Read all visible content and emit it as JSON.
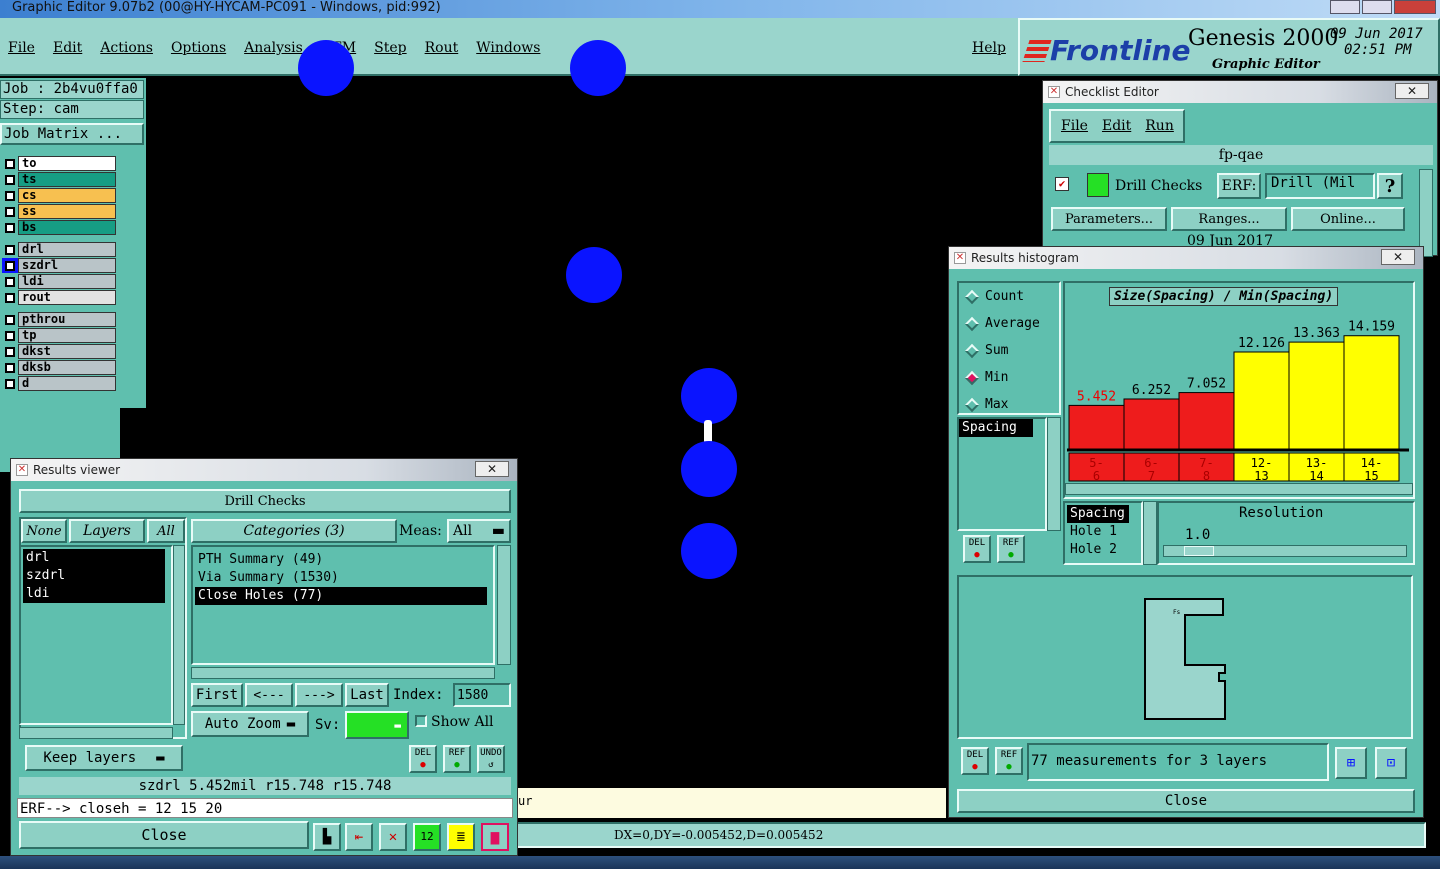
{
  "window_title": "Graphic Editor 9.07b2 (00@HY-HYCAM-PC091 - Windows, pid:992)",
  "menu": [
    "File",
    "Edit",
    "Actions",
    "Options",
    "Analysis",
    "DFM",
    "Step",
    "Rout",
    "Windows"
  ],
  "help": "Help",
  "brand": {
    "logo": "Frontline",
    "product": "Genesis 2000",
    "subtitle": "Graphic Editor",
    "date": "09 Jun 2017",
    "time": "02:51 PM"
  },
  "job": {
    "job_label": "Job : 2b4vu0ffa0",
    "step_label": "Step: cam",
    "matrix_btn": "Job Matrix ..."
  },
  "layers": [
    {
      "name": "to",
      "color": "#ffffff"
    },
    {
      "name": "ts",
      "color": "#169d84"
    },
    {
      "name": "cs",
      "color": "#f7c050"
    },
    {
      "name": "ss",
      "color": "#f7c050"
    },
    {
      "name": "bs",
      "color": "#169d84"
    },
    {
      "name": "drl",
      "color": "#b9c4c8"
    },
    {
      "name": "szdrl",
      "color": "#b9c4c8"
    },
    {
      "name": "ldi",
      "color": "#b9c4c8"
    },
    {
      "name": "rout",
      "color": "#e2e2e2"
    },
    {
      "name": "pthrou",
      "color": "#b9c4c8"
    },
    {
      "name": "tp",
      "color": "#b9c4c8"
    },
    {
      "name": "dkst",
      "color": "#b9c4c8"
    },
    {
      "name": "dksb",
      "color": "#b9c4c8"
    },
    {
      "name": "d",
      "color": "#b9c4c8"
    }
  ],
  "results_viewer": {
    "title": "Results viewer",
    "heading": "Drill Checks",
    "none_btn": "None",
    "layers_btn": "Layers",
    "all_btn": "All",
    "categories_btn": "Categories (3)",
    "meas_label": "Meas:",
    "meas_value": "All",
    "layer_list": [
      "drl",
      "szdrl",
      "ldi"
    ],
    "categories": [
      "PTH Summary (49)",
      "Via Summary (1530)",
      "Close Holes (77)"
    ],
    "first": "First",
    "prev": "<---",
    "next": "--->",
    "last": "Last",
    "index_label": "Index:",
    "index_value": "1580",
    "auto_zoom": "Auto Zoom",
    "sv_label": "Sv:",
    "show_all": "Show All",
    "keep_layers": "Keep layers",
    "del": "DEL",
    "ref": "REF",
    "undo": "UNDO",
    "info": "szdrl 5.452mil  r15.748  r15.748",
    "erf": "ERF--> closeh = 12 15 20",
    "close": "Close"
  },
  "checklist": {
    "title": "Checklist Editor",
    "menu": [
      "File",
      "Edit",
      "Run"
    ],
    "name": "fp-qae",
    "check_name": "Drill Checks",
    "erf_label": "ERF:",
    "erf_value": "Drill (Mil",
    "help": "?",
    "parameters": "Parameters...",
    "ranges": "Ranges...",
    "online": "Online...",
    "date": "09 Jun 2017"
  },
  "histogram": {
    "title": "Results histogram",
    "modes": [
      "Count",
      "Average",
      "Sum",
      "Min",
      "Max"
    ],
    "selected_mode": "Min",
    "list_item": "Spacing",
    "chart_title": "Size(Spacing) / Min(Spacing)",
    "del": "DEL",
    "ref": "REF",
    "spacing_list": [
      "Spacing",
      "Hole 1",
      "Hole 2"
    ],
    "resolution_label": "Resolution",
    "resolution_value": "1.0",
    "preview_tag": "Fs",
    "summary": "77 measurements for 3 layers",
    "close": "Close"
  },
  "chart_data": {
    "type": "bar",
    "title": "Size(Spacing) / Min(Spacing)",
    "categories": [
      "5-6",
      "6-7",
      "7-8",
      "12-13",
      "13-14",
      "14-15"
    ],
    "values": [
      5.452,
      6.252,
      7.052,
      12.126,
      13.363,
      14.159
    ],
    "value_labels": [
      "5.452",
      "6.252",
      "7.052",
      "12.126",
      "13.363",
      "14.159"
    ],
    "colors": [
      "#ee1c1c",
      "#ee1c1c",
      "#ee1c1c",
      "#ffff00",
      "#ffff00",
      "#ffff00"
    ],
    "ylim": [
      0,
      16
    ]
  },
  "status_bar": "DX=0,DY=-0.005452,D=0.005452",
  "status_partial": "ur"
}
